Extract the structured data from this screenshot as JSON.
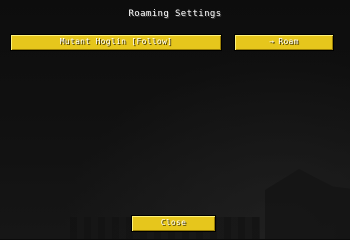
{
  "screen": {
    "title": "Roaming Settings"
  },
  "entries": [
    {
      "entity_label": "Mutant Hoglin [Follow]",
      "action_arrow": "→",
      "action_label": "Roam"
    }
  ],
  "footer": {
    "close_label": "Close"
  },
  "colors": {
    "button_face": "#e6c61c",
    "button_text": "#ffffff",
    "background": "#0b0b0b"
  }
}
